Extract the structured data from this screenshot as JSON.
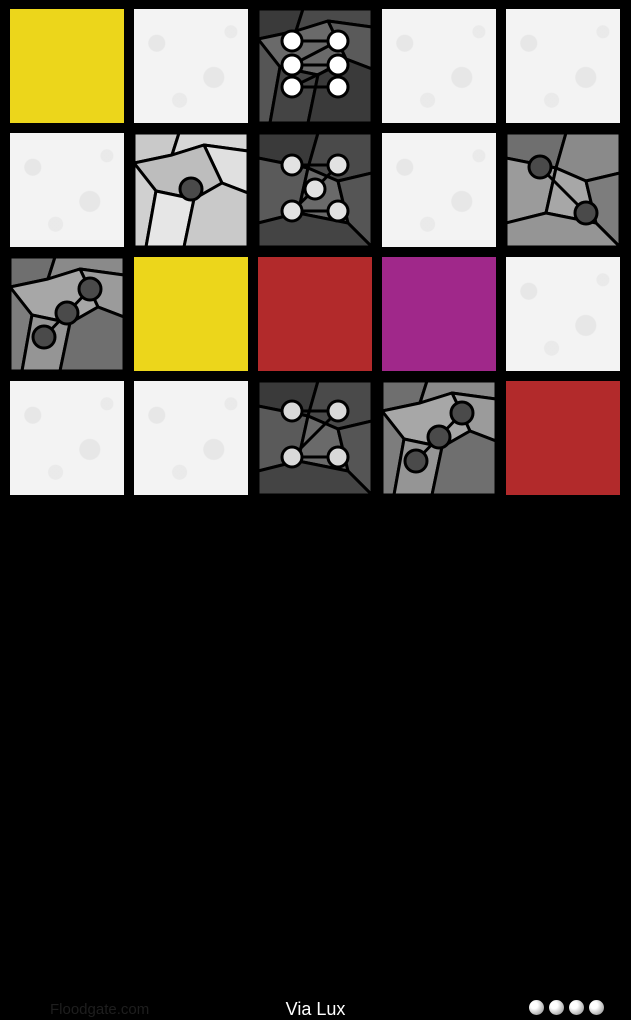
{
  "game": {
    "title": "Via Lux",
    "brand": "Floodgate.com",
    "lives": 4,
    "colors": {
      "yellow": "#ecd61b",
      "red": "#b22a2b",
      "purple": "#a0288a",
      "white": "#f3f3f3",
      "black": "#000000"
    },
    "board": {
      "rows": 4,
      "cols": 5,
      "tiles": [
        [
          {
            "kind": "color",
            "color": "yellow"
          },
          {
            "kind": "color",
            "color": "white"
          },
          {
            "kind": "pattern",
            "pattern": "six-dots",
            "shade": "dark"
          },
          {
            "kind": "color",
            "color": "white"
          },
          {
            "kind": "color",
            "color": "white"
          }
        ],
        [
          {
            "kind": "color",
            "color": "white"
          },
          {
            "kind": "pattern",
            "pattern": "one-dot",
            "shade": "light"
          },
          {
            "kind": "pattern",
            "pattern": "five-dots",
            "shade": "dark"
          },
          {
            "kind": "color",
            "color": "white"
          },
          {
            "kind": "pattern",
            "pattern": "two-dots",
            "shade": "mid"
          }
        ],
        [
          {
            "kind": "pattern",
            "pattern": "three-dots",
            "shade": "mid"
          },
          {
            "kind": "color",
            "color": "yellow"
          },
          {
            "kind": "color",
            "color": "red"
          },
          {
            "kind": "color",
            "color": "purple"
          },
          {
            "kind": "color",
            "color": "white"
          }
        ],
        [
          {
            "kind": "color",
            "color": "white"
          },
          {
            "kind": "color",
            "color": "white"
          },
          {
            "kind": "pattern",
            "pattern": "four-dots",
            "shade": "dark"
          },
          {
            "kind": "pattern",
            "pattern": "three-dots",
            "shade": "mid"
          },
          {
            "kind": "color",
            "color": "red"
          }
        ]
      ]
    }
  }
}
